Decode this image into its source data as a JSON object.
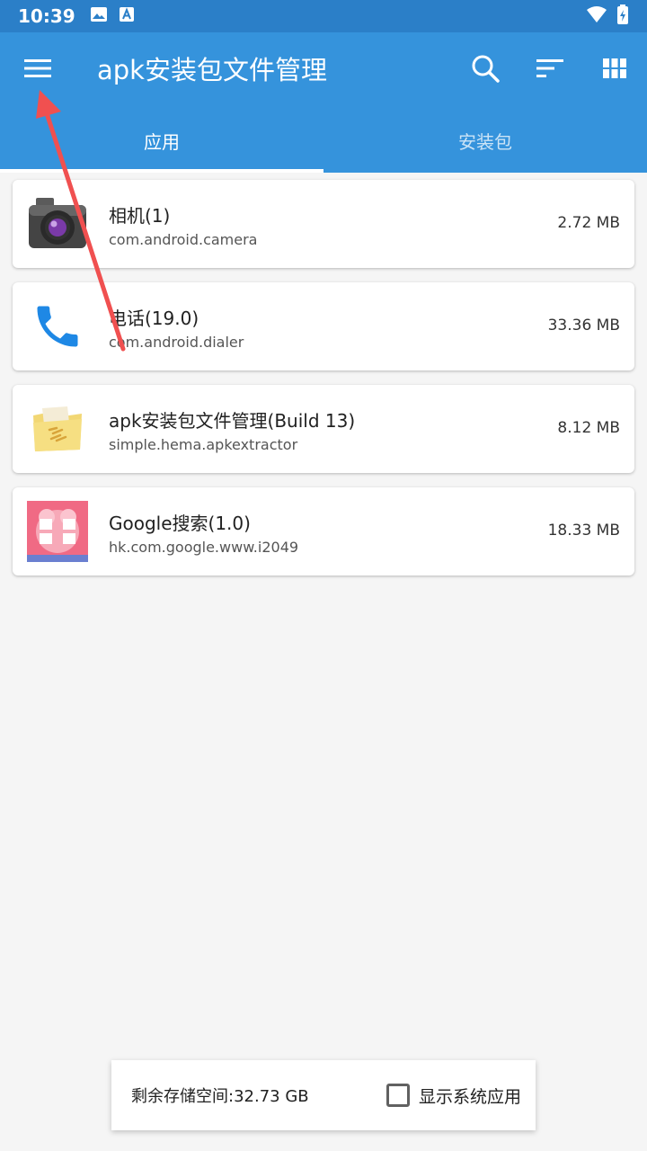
{
  "status_bar": {
    "time": "10:39"
  },
  "appbar": {
    "title": "apk安装包文件管理",
    "icons": [
      "menu-icon",
      "search-icon",
      "sort-icon",
      "grid-view-icon"
    ]
  },
  "tabs": [
    {
      "label": "应用",
      "selected": true
    },
    {
      "label": "安装包",
      "selected": false
    }
  ],
  "apps": [
    {
      "name": "相机(1)",
      "package": "com.android.camera",
      "size": "2.72 MB",
      "icon": "camera-app-icon"
    },
    {
      "name": "电话(19.0)",
      "package": "com.android.dialer",
      "size": "33.36 MB",
      "icon": "phone-app-icon"
    },
    {
      "name": "apk安装包文件管理(Build 13)",
      "package": "simple.hema.apkextractor",
      "size": "8.12 MB",
      "icon": "folder-app-icon"
    },
    {
      "name": "Google搜索(1.0)",
      "package": "hk.com.google.www.i2049",
      "size": "18.33 MB",
      "icon": "google-search-app-icon"
    }
  ],
  "footer": {
    "storage": "剩余存储空间:32.73 GB",
    "show_system_label": "显示系统应用",
    "show_system_checked": false
  },
  "colors": {
    "appbar": "#3593dc",
    "status_bar": "#2b7fc8",
    "annotation_arrow": "#f05050"
  }
}
